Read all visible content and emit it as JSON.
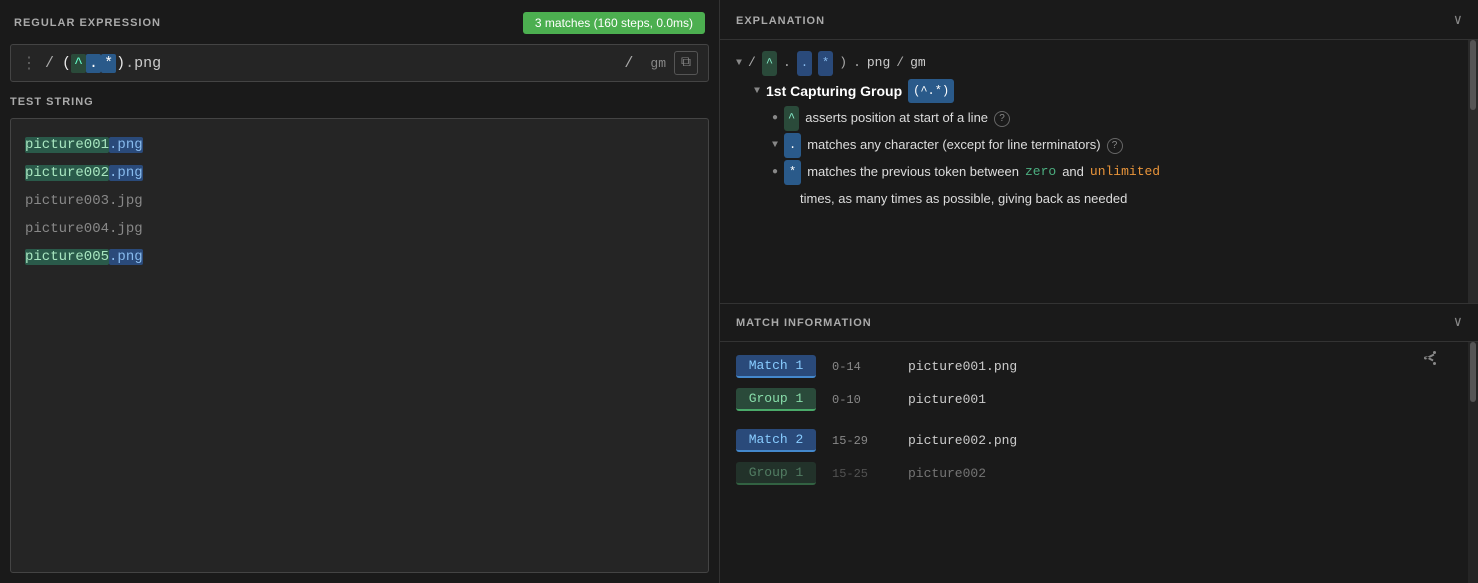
{
  "leftPanel": {
    "sectionTitle": "REGULAR EXPRESSION",
    "matchesBadge": "3 matches (160 steps, 0.0ms)",
    "regexSlash1": "/",
    "regexParen1": "(",
    "regexCaret": "^",
    "regexDot": ".",
    "regexStar": "*",
    "regexParen2": ")",
    "regexDotLiteral": ".",
    "regexPng": "png",
    "regexSlash2": "/",
    "regexFlags": "gm",
    "testStringTitle": "TEST STRING",
    "testLines": [
      {
        "text": "picture001.png",
        "hasMatch": true,
        "matchStart": 0,
        "matchEnd": 14,
        "groupStart": 0,
        "groupEnd": 10
      },
      {
        "text": "picture002.png",
        "hasMatch": true,
        "matchStart": 0,
        "matchEnd": 14,
        "groupStart": 0,
        "groupEnd": 10
      },
      {
        "text": "picture003.jpg",
        "hasMatch": false
      },
      {
        "text": "picture004.jpg",
        "hasMatch": false
      },
      {
        "text": "picture005.png",
        "hasMatch": true,
        "matchStart": 0,
        "matchEnd": 14,
        "groupStart": 0,
        "groupEnd": 10
      }
    ]
  },
  "rightPanel": {
    "explanationTitle": "EXPLANATION",
    "regexDisplay": {
      "slash1": "/",
      "paren1": "(",
      "caret": "^",
      "dot": ".",
      "star": "*",
      "paren2": ")",
      "dotLiteral": ".",
      "png": "png",
      "slash2": "/",
      "flags": "gm"
    },
    "capturingGroupLabel": "1st Capturing Group",
    "capturingGroupCode": "(^.*)",
    "caretDesc": "asserts position at start of a line",
    "dotDesc": "matches any character (except for line terminators)",
    "starDescPre": "matches the previous token between",
    "starDescZero": "zero",
    "starDescAnd": "and",
    "starDescUnlimited": "unlimited",
    "starDescPost": "times, as many times as possible, giving back as needed",
    "matchInfoTitle": "MATCH INFORMATION",
    "matches": [
      {
        "type": "match",
        "label": "Match 1",
        "range": "0-14",
        "value": "picture001.png"
      },
      {
        "type": "group",
        "label": "Group 1",
        "range": "0-10",
        "value": "picture001"
      },
      {
        "type": "match",
        "label": "Match 2",
        "range": "15-29",
        "value": "picture002.png"
      },
      {
        "type": "group",
        "label": "Group 1",
        "range": "15-25",
        "value": "picture002"
      }
    ]
  }
}
